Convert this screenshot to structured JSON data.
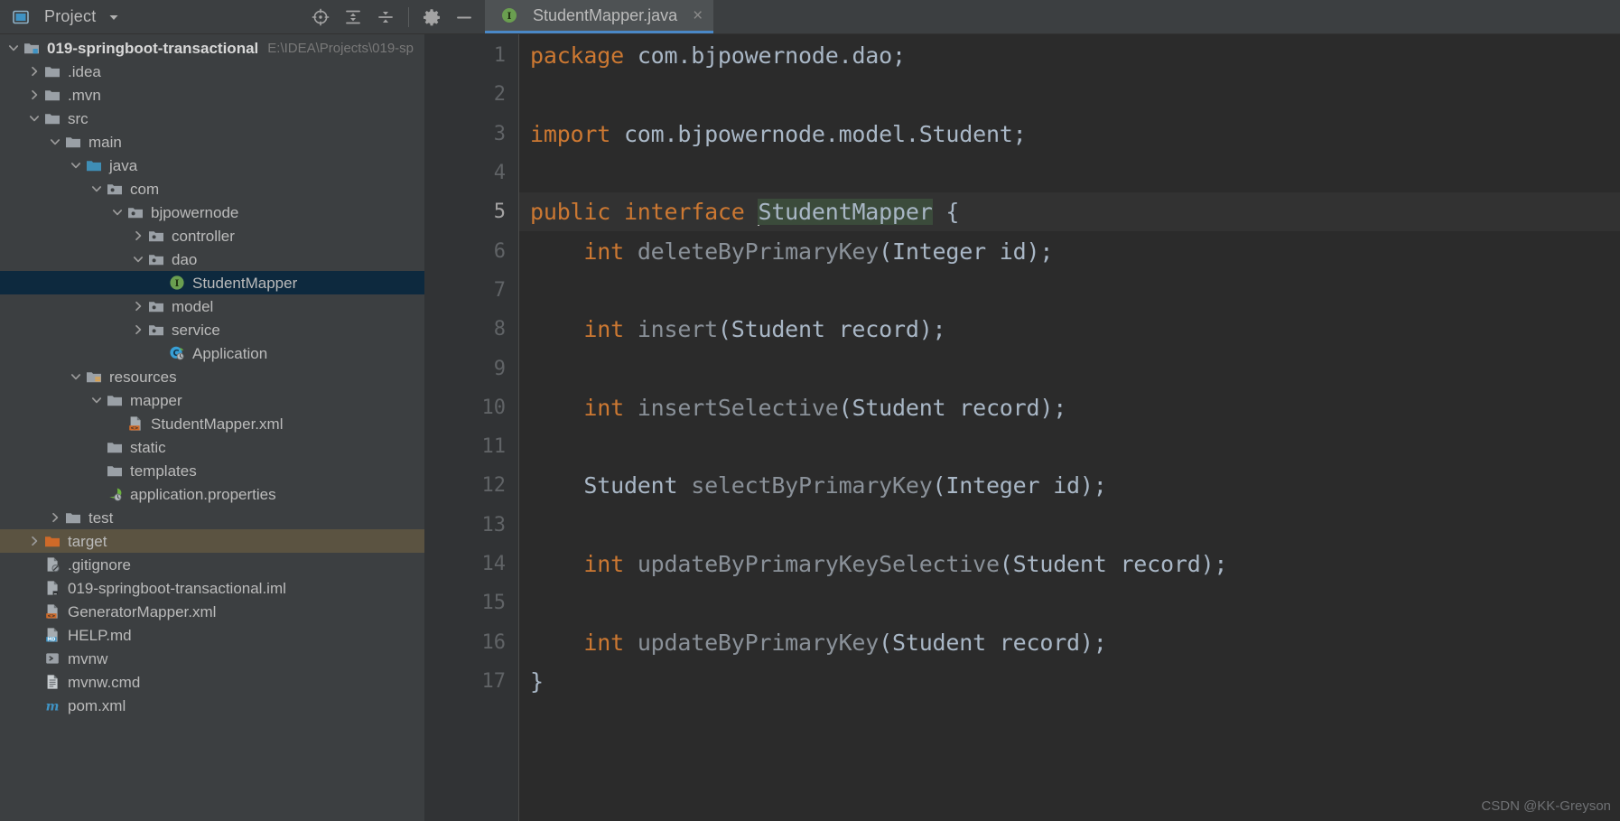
{
  "toolwindow": {
    "title": "Project",
    "dropdown_icon": "chevron-down-icon",
    "window_icon": "project-window-icon",
    "actions": [
      {
        "name": "select-opened-file-icon",
        "label": "Select Opened File"
      },
      {
        "name": "expand-all-icon",
        "label": "Expand All"
      },
      {
        "name": "collapse-all-icon",
        "label": "Collapse All"
      },
      {
        "name": "gear-icon",
        "label": "Options"
      },
      {
        "name": "minimize-icon",
        "label": "Hide"
      }
    ]
  },
  "tabs": [
    {
      "label": "StudentMapper.java",
      "icon": "interface-icon",
      "active": true,
      "close_label": "×"
    }
  ],
  "tree": [
    {
      "label": "019-springboot-transactional",
      "path": "E:\\IDEA\\Projects\\019-sp",
      "indent": 0,
      "arrow": "down",
      "icon": "module-folder-icon",
      "bold": true,
      "state": "none"
    },
    {
      "label": ".idea",
      "indent": 1,
      "arrow": "right",
      "icon": "folder-icon",
      "state": "none"
    },
    {
      "label": ".mvn",
      "indent": 1,
      "arrow": "right",
      "icon": "folder-icon",
      "state": "none"
    },
    {
      "label": "src",
      "indent": 1,
      "arrow": "down",
      "icon": "folder-icon",
      "state": "none"
    },
    {
      "label": "main",
      "indent": 2,
      "arrow": "down",
      "icon": "folder-icon",
      "state": "none"
    },
    {
      "label": "java",
      "indent": 3,
      "arrow": "down",
      "icon": "source-root-folder-icon",
      "state": "none"
    },
    {
      "label": "com",
      "indent": 4,
      "arrow": "down",
      "icon": "package-icon",
      "state": "none"
    },
    {
      "label": "bjpowernode",
      "indent": 5,
      "arrow": "down",
      "icon": "package-icon",
      "state": "none"
    },
    {
      "label": "controller",
      "indent": 6,
      "arrow": "right",
      "icon": "package-icon",
      "state": "none"
    },
    {
      "label": "dao",
      "indent": 6,
      "arrow": "down",
      "icon": "package-icon",
      "state": "none"
    },
    {
      "label": "StudentMapper",
      "indent": 7,
      "arrow": "none",
      "icon": "interface-icon",
      "state": "selected"
    },
    {
      "label": "model",
      "indent": 6,
      "arrow": "right",
      "icon": "package-icon",
      "state": "none"
    },
    {
      "label": "service",
      "indent": 6,
      "arrow": "right",
      "icon": "package-icon",
      "state": "none"
    },
    {
      "label": "Application",
      "indent": 7,
      "arrow": "none",
      "icon": "spring-class-icon",
      "state": "none"
    },
    {
      "label": "resources",
      "indent": 3,
      "arrow": "down",
      "icon": "resource-root-folder-icon",
      "state": "none"
    },
    {
      "label": "mapper",
      "indent": 4,
      "arrow": "down",
      "icon": "folder-icon",
      "state": "none"
    },
    {
      "label": "StudentMapper.xml",
      "indent": 5,
      "arrow": "none",
      "icon": "xml-file-icon",
      "state": "none"
    },
    {
      "label": "static",
      "indent": 4,
      "arrow": "none",
      "icon": "folder-icon",
      "state": "none"
    },
    {
      "label": "templates",
      "indent": 4,
      "arrow": "none",
      "icon": "folder-icon",
      "state": "none"
    },
    {
      "label": "application.properties",
      "indent": 4,
      "arrow": "none",
      "icon": "spring-properties-icon",
      "state": "none"
    },
    {
      "label": "test",
      "indent": 2,
      "arrow": "right",
      "icon": "folder-icon",
      "state": "none"
    },
    {
      "label": "target",
      "indent": 1,
      "arrow": "right",
      "icon": "excluded-folder-icon",
      "state": "hovered"
    },
    {
      "label": ".gitignore",
      "indent": 1,
      "arrow": "none",
      "icon": "gitignore-file-icon",
      "state": "none"
    },
    {
      "label": "019-springboot-transactional.iml",
      "indent": 1,
      "arrow": "none",
      "icon": "iml-file-icon",
      "state": "none"
    },
    {
      "label": "GeneratorMapper.xml",
      "indent": 1,
      "arrow": "none",
      "icon": "xml-file-icon",
      "state": "none"
    },
    {
      "label": "HELP.md",
      "indent": 1,
      "arrow": "none",
      "icon": "markdown-file-icon",
      "state": "none"
    },
    {
      "label": "mvnw",
      "indent": 1,
      "arrow": "none",
      "icon": "shell-script-icon",
      "state": "none"
    },
    {
      "label": "mvnw.cmd",
      "indent": 1,
      "arrow": "none",
      "icon": "text-file-icon",
      "state": "none"
    },
    {
      "label": "pom.xml",
      "indent": 1,
      "arrow": "none",
      "icon": "maven-file-icon",
      "state": "none"
    }
  ],
  "editor": {
    "current_line": 5,
    "lines": [
      {
        "n": 1,
        "tokens": [
          {
            "t": "package",
            "c": "kw"
          },
          {
            "t": " com.bjpowernode.dao;",
            "c": "idn"
          }
        ]
      },
      {
        "n": 2,
        "tokens": []
      },
      {
        "n": 3,
        "tokens": [
          {
            "t": "import",
            "c": "kw"
          },
          {
            "t": " com.bjpowernode.model.Student;",
            "c": "idn"
          }
        ]
      },
      {
        "n": 4,
        "tokens": []
      },
      {
        "n": 5,
        "tokens": [
          {
            "t": "public interface ",
            "c": "kw"
          },
          {
            "t": "StudentMapper",
            "c": "idn hl caret"
          },
          {
            "t": " {",
            "c": "idn"
          }
        ]
      },
      {
        "n": 6,
        "tokens": [
          {
            "t": "    int ",
            "c": "kw"
          },
          {
            "t": "deleteByPrimaryKey",
            "c": "mth"
          },
          {
            "t": "(Integer id);",
            "c": "idn"
          }
        ]
      },
      {
        "n": 7,
        "tokens": []
      },
      {
        "n": 8,
        "tokens": [
          {
            "t": "    int ",
            "c": "kw"
          },
          {
            "t": "insert",
            "c": "mth"
          },
          {
            "t": "(Student record);",
            "c": "idn"
          }
        ]
      },
      {
        "n": 9,
        "tokens": []
      },
      {
        "n": 10,
        "tokens": [
          {
            "t": "    int ",
            "c": "kw"
          },
          {
            "t": "insertSelective",
            "c": "mth"
          },
          {
            "t": "(Student record);",
            "c": "idn"
          }
        ]
      },
      {
        "n": 11,
        "tokens": []
      },
      {
        "n": 12,
        "tokens": [
          {
            "t": "    Student ",
            "c": "idn"
          },
          {
            "t": "selectByPrimaryKey",
            "c": "mth"
          },
          {
            "t": "(Integer id);",
            "c": "idn"
          }
        ]
      },
      {
        "n": 13,
        "tokens": []
      },
      {
        "n": 14,
        "tokens": [
          {
            "t": "    int ",
            "c": "kw"
          },
          {
            "t": "updateByPrimaryKeySelective",
            "c": "mth"
          },
          {
            "t": "(Student record);",
            "c": "idn"
          }
        ]
      },
      {
        "n": 15,
        "tokens": []
      },
      {
        "n": 16,
        "tokens": [
          {
            "t": "    int ",
            "c": "kw"
          },
          {
            "t": "updateByPrimaryKey",
            "c": "mth"
          },
          {
            "t": "(Student record);",
            "c": "idn"
          }
        ]
      },
      {
        "n": 17,
        "tokens": [
          {
            "t": "}",
            "c": "idn"
          }
        ]
      }
    ]
  },
  "watermark": "CSDN @KK-Greyson",
  "colors": {
    "keyword": "#cc7832",
    "identifier": "#a9b7c6",
    "method": "#8a9199",
    "editor_bg": "#2b2b2b",
    "panel_bg": "#3c3f41",
    "selection": "#0d293e",
    "hover": "#5b5341",
    "tab_underline": "#4a88c7"
  }
}
